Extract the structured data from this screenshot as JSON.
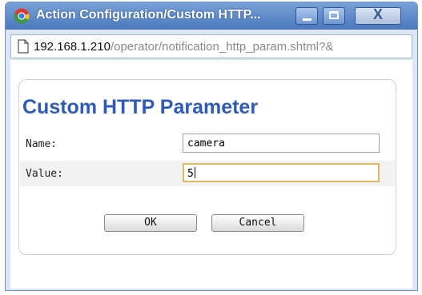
{
  "window": {
    "title": "Action Configuration/Custom HTTP...",
    "controls": {
      "close_label": "X"
    }
  },
  "address_bar": {
    "host": "192.168.1.210",
    "path": "/operator/notification_http_param.shtml?&"
  },
  "dialog": {
    "title": "Custom HTTP Parameter",
    "fields": [
      {
        "label": "Name:",
        "value": "camera"
      },
      {
        "label": "Value:",
        "value": "5"
      }
    ],
    "buttons": {
      "ok": "OK",
      "cancel": "Cancel"
    }
  },
  "icons": [
    "chrome-icon",
    "minimize-icon",
    "maximize-icon",
    "close-icon",
    "page-icon"
  ],
  "colors": {
    "titlebar": "#4a78bd",
    "heading": "#2f5bb5",
    "focus_border": "#e0b860"
  }
}
